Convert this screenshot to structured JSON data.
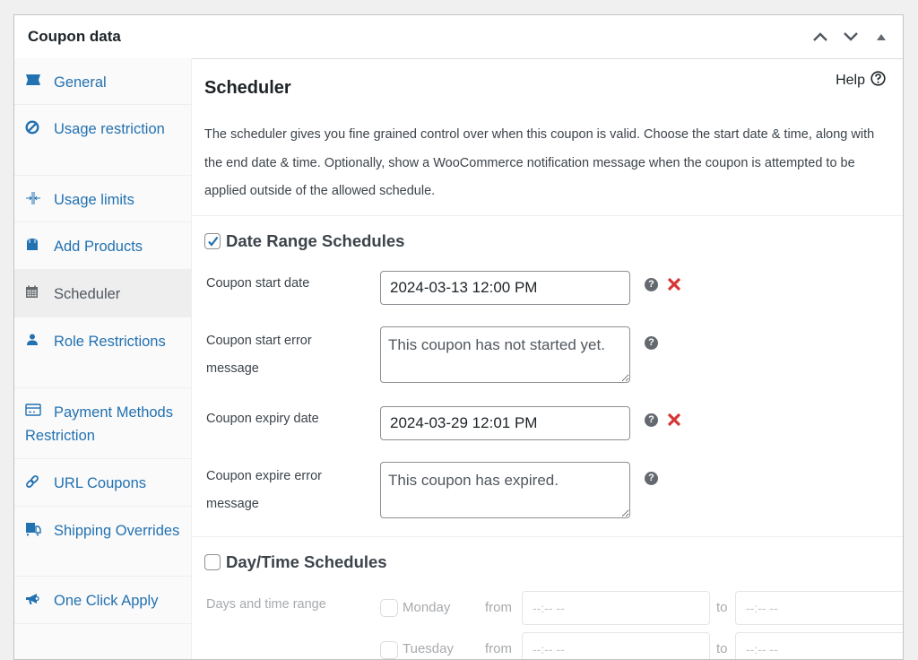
{
  "panel": {
    "title": "Coupon data",
    "controls": [
      "chevron-up-icon",
      "chevron-down-icon",
      "triangle-up-icon"
    ]
  },
  "sidebar": {
    "items": [
      {
        "label": "General",
        "icon": "ticket-icon",
        "active": false
      },
      {
        "label": "Usage restriction",
        "icon": "block-icon",
        "active": false
      },
      {
        "label": "Usage limits",
        "icon": "arrows-in-icon",
        "active": false
      },
      {
        "label": "Add Products",
        "icon": "bag-icon",
        "active": false
      },
      {
        "label": "Scheduler",
        "icon": "calendar-icon",
        "active": true
      },
      {
        "label": "Role Restrictions",
        "icon": "user-icon",
        "active": false
      },
      {
        "label": "Payment Methods Restriction",
        "icon": "card-icon",
        "active": false
      },
      {
        "label": "URL Coupons",
        "icon": "link-icon",
        "active": false
      },
      {
        "label": "Shipping Overrides",
        "icon": "truck-icon",
        "active": false
      },
      {
        "label": "One Click Apply",
        "icon": "megaphone-icon",
        "active": false
      }
    ]
  },
  "scheduler": {
    "help_label": "Help",
    "title": "Scheduler",
    "description": "The scheduler gives you fine grained control over when this coupon is valid. Choose the start date & time, along with the end date & time. Optionally, show a WooCommerce notification message when the coupon is attempted to be applied outside of the allowed schedule.",
    "date_range": {
      "label": "Date Range Schedules",
      "checked": true,
      "start_date_label": "Coupon start date",
      "start_date_value": "2024-03-13 12:00 PM",
      "start_error_label": "Coupon start error message",
      "start_error_value": "This coupon has not started yet.",
      "expiry_date_label": "Coupon expiry date",
      "expiry_date_value": "2024-03-29 12:01 PM",
      "expire_error_label": "Coupon expire error message",
      "expire_error_value": "This coupon has expired."
    },
    "day_time": {
      "label": "Day/Time Schedules",
      "checked": false,
      "range_label": "Days and time range",
      "from_label": "from",
      "to_label": "to",
      "time_placeholder": "--:-- --",
      "days": [
        {
          "label": "Monday",
          "checked": false
        },
        {
          "label": "Tuesday",
          "checked": false
        }
      ]
    }
  }
}
